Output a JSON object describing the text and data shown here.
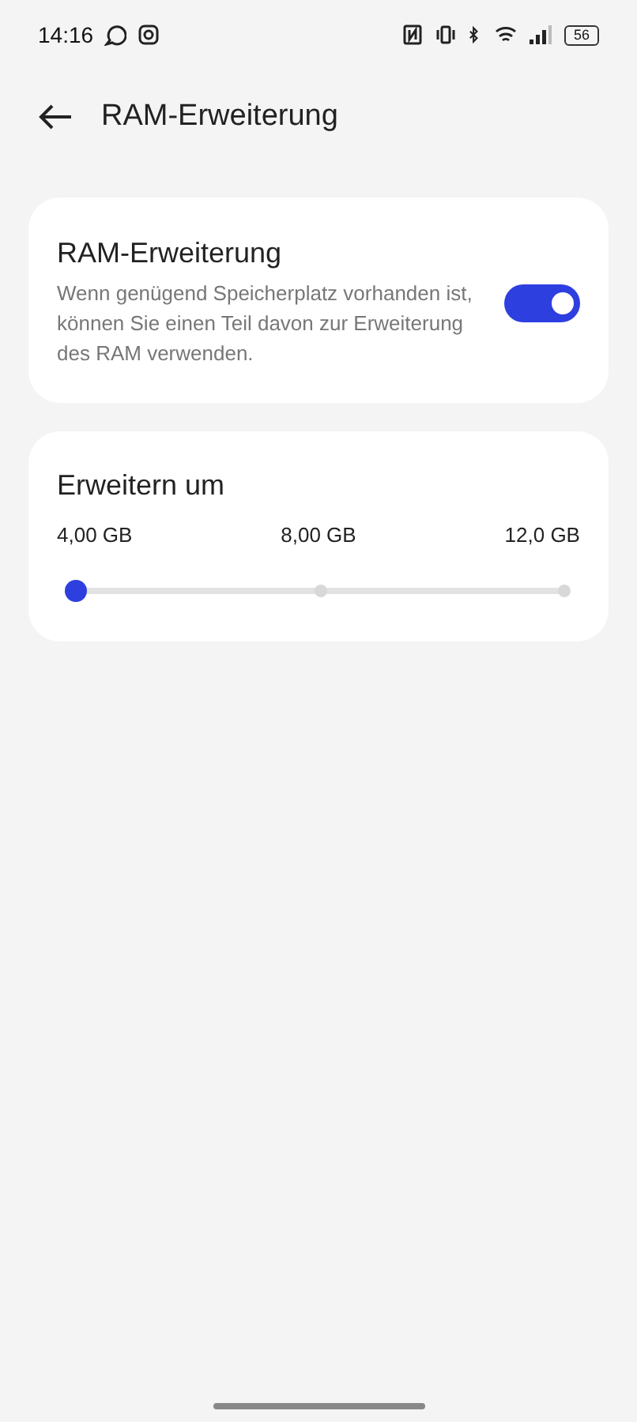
{
  "status_bar": {
    "time": "14:16",
    "battery": "56"
  },
  "header": {
    "title": "RAM-Erweiterung"
  },
  "toggle_card": {
    "title": "RAM-Erweiterung",
    "description": "Wenn genügend Speicherplatz vorhanden ist, können Sie einen Teil davon zur Erweiterung des RAM verwenden.",
    "on": true
  },
  "slider_card": {
    "title": "Erweitern um",
    "stops": [
      "4,00 GB",
      "8,00 GB",
      "12,0 GB"
    ],
    "level": 0
  }
}
